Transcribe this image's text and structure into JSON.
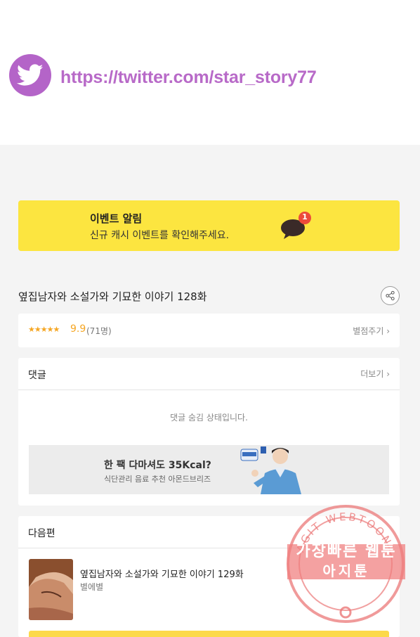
{
  "banner": {
    "url_text": "https://twitter.com/star_story77",
    "brand_color": "#b464c8"
  },
  "event": {
    "title": "이벤트 알림",
    "subtitle": "신규 캐시 이벤트를 확인해주세요.",
    "badge_count": "1",
    "background": "#fce540"
  },
  "episode": {
    "title": "옆집남자와 소설가와 기묘한 이야기 128화",
    "share_icon": "share-icon"
  },
  "rating": {
    "stars": "★★★★★",
    "score": "9.9",
    "count": "(71명)",
    "rate_link": "별점주기 ›"
  },
  "comments": {
    "heading": "댓글",
    "more": "더보기 ›",
    "hidden_message": "댓글 숨김 상태입니다."
  },
  "ad": {
    "title": "한 팩 다마셔도 35Kcal?",
    "subtitle": "식단관리 음료 추천 아몬드브리즈"
  },
  "next_episode": {
    "heading": "다음편",
    "title": "옆집남자와 소설가와 기묘한 이야기 129화",
    "author": "별에별"
  },
  "watermark": {
    "ring_text": "AGIT WEBTOON",
    "line1": "가장빠른 웹툰",
    "line2": "아지툰"
  }
}
